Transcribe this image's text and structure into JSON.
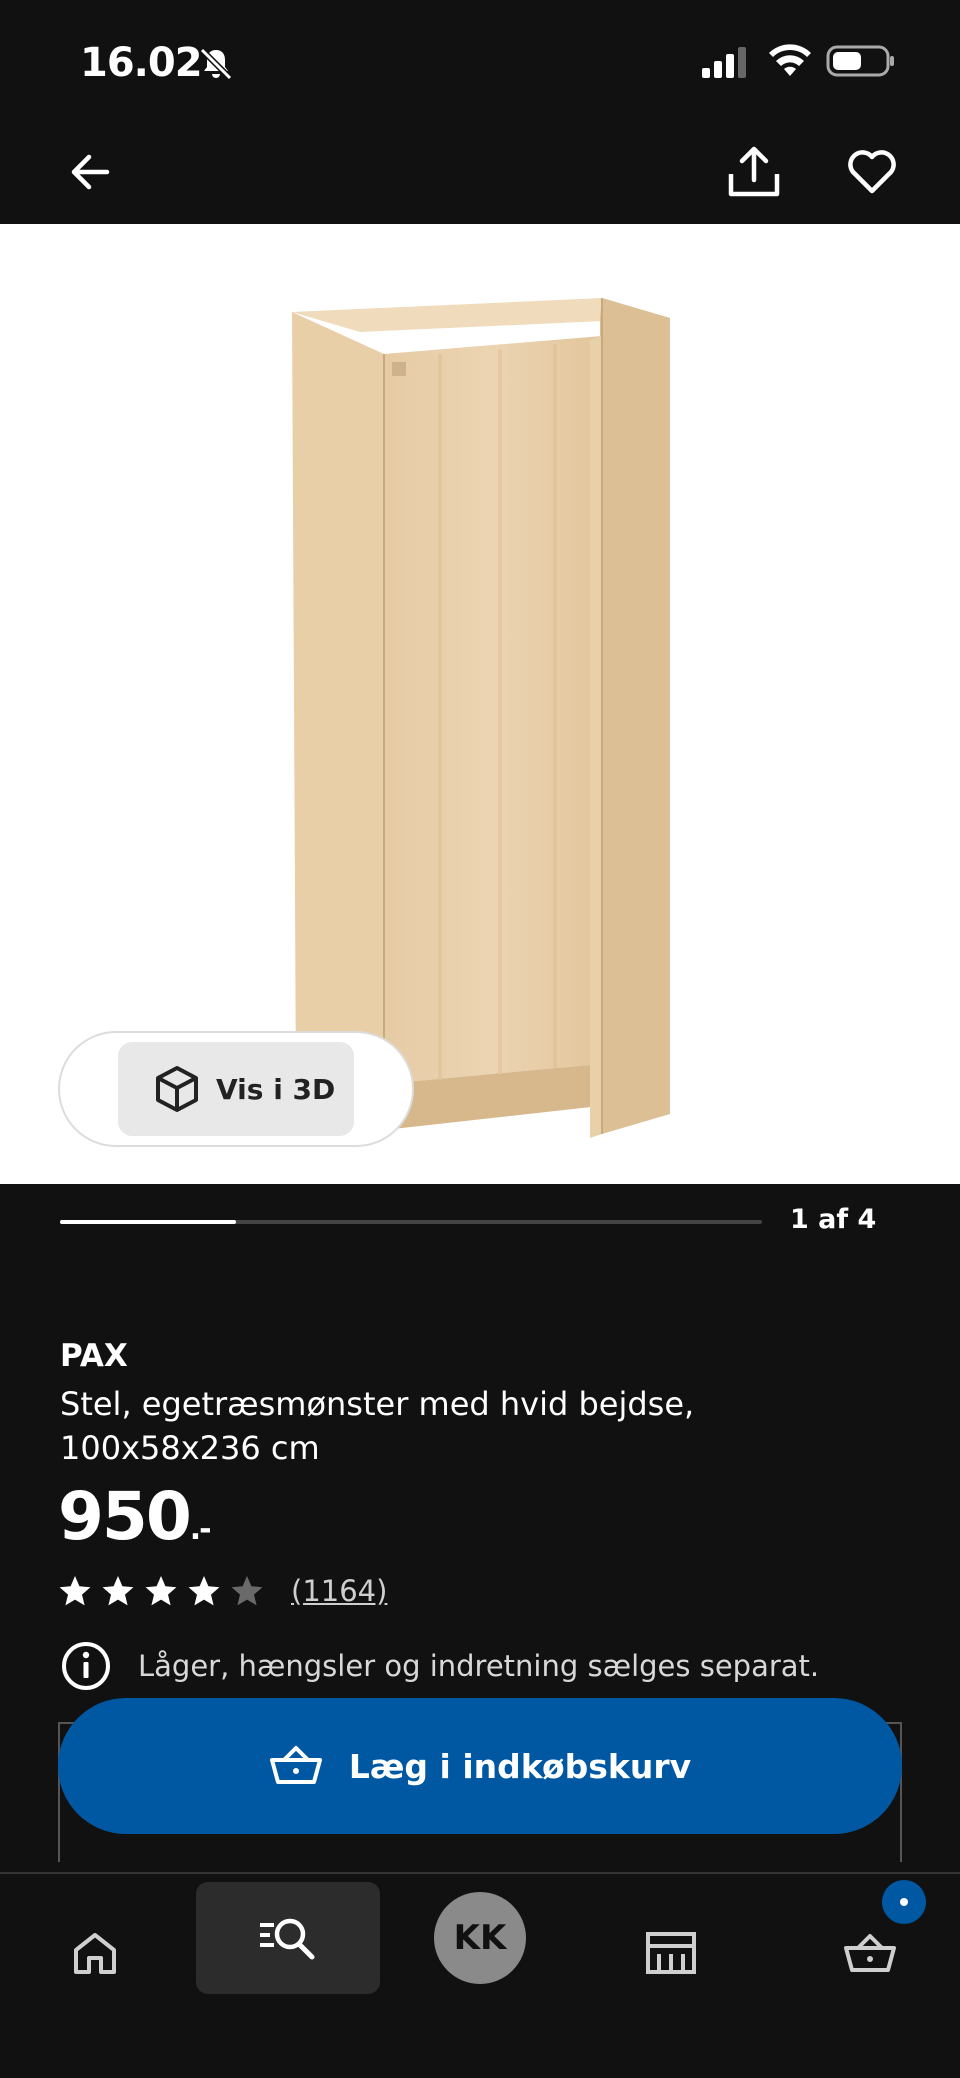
{
  "status_bar": {
    "time": "16.02",
    "icons": [
      "bell-muted-icon",
      "cellular-signal-icon",
      "wifi-icon",
      "battery-icon"
    ]
  },
  "top_nav": {
    "icons": [
      "arrow-left-icon",
      "share-icon",
      "heart-icon"
    ]
  },
  "gallery": {
    "view_3d_label": "Vis i 3D",
    "page_counter": "1 af 4",
    "current_page": 1,
    "total_pages": 4
  },
  "product": {
    "brand": "PAX",
    "description": "Stel, egetræsmønster med hvid bejdse, 100x58x236 cm",
    "price": "950",
    "price_suffix": ".-",
    "rating": 4,
    "rating_max": 5,
    "review_count": "(1164)",
    "info_note": "Låger, hængsler og indretning sælges separat."
  },
  "actions": {
    "add_to_cart_label": "Læg i indkøbskurv"
  },
  "bottom_nav": {
    "profile_initials": "KK",
    "items": [
      "home-icon",
      "search-icon",
      "profile-avatar",
      "store-icon",
      "cart-icon"
    ]
  },
  "colors": {
    "background": "#111111",
    "primary_blue": "#0058a3",
    "text_white": "#ffffff"
  }
}
